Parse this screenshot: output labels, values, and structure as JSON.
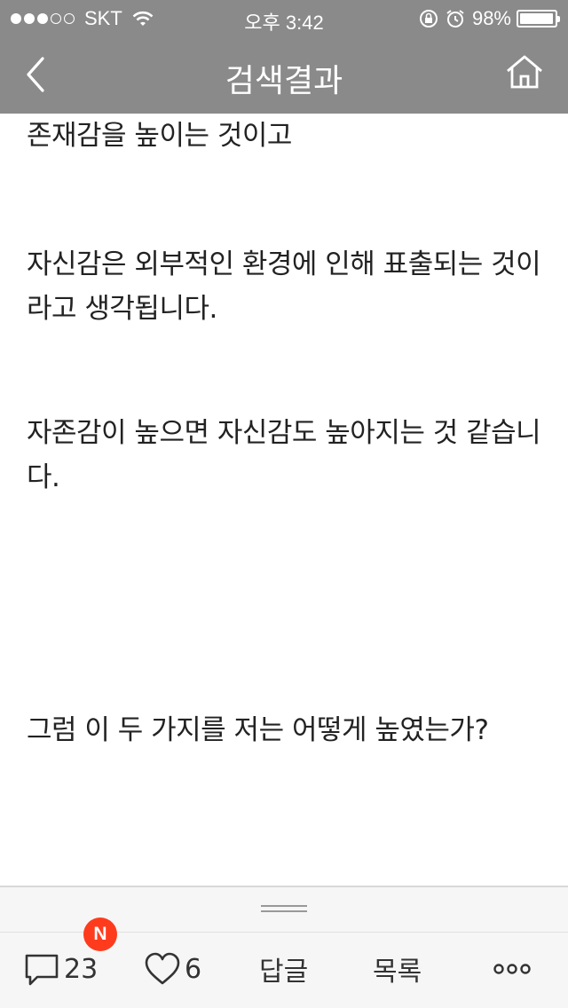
{
  "status_bar": {
    "carrier": "SKT",
    "time": "오후 3:42",
    "battery": "98%",
    "battery_level": 0.98
  },
  "nav": {
    "title": "검색결과",
    "back_icon": "chevron-left-icon",
    "home_icon": "home-icon"
  },
  "content": {
    "paragraphs": [
      "존재감을 높이는 것이고",
      "자신감은 외부적인 환경에 인해 표출되는 것이라고 생각됩니다.",
      "자존감이 높으면 자신감도 높아지는 것 같습니다.",
      "그럼 이 두 가지를 저는 어떻게 높였는가?"
    ]
  },
  "toolbar": {
    "new_badge": "N",
    "comment_count": "23",
    "like_count": "6",
    "reply_label": "답글",
    "list_label": "목록",
    "more_icon": "more-dots-icon"
  },
  "colors": {
    "nav_background": "#8a8a8a",
    "badge": "#ff3b1d",
    "toolbar_background": "#f6f6f6"
  }
}
